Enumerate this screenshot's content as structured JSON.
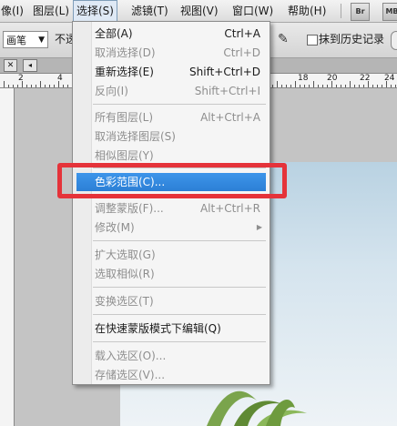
{
  "menubar": {
    "items": [
      "像(I)",
      "图层(L)",
      "选择(S)",
      "滤镜(T)",
      "视图(V)",
      "窗口(W)",
      "帮助(H)"
    ],
    "active_index": 2,
    "br_label": "Br",
    "mb_label": "MB"
  },
  "options": {
    "tool_value": "画笔",
    "opacity_label": "不透",
    "history_label": "抹到历史记录"
  },
  "ruler": {
    "numbers": [
      "2",
      "4",
      "18",
      "20",
      "22",
      "24",
      "2"
    ]
  },
  "select_menu": {
    "items": [
      {
        "label": "全部(A)",
        "shortcut": "Ctrl+A",
        "state": "enabled"
      },
      {
        "label": "取消选择(D)",
        "shortcut": "Ctrl+D",
        "state": "disabled"
      },
      {
        "label": "重新选择(E)",
        "shortcut": "Shift+Ctrl+D",
        "state": "enabled"
      },
      {
        "label": "反向(I)",
        "shortcut": "Shift+Ctrl+I",
        "state": "disabled"
      },
      {
        "label": "所有图层(L)",
        "shortcut": "Alt+Ctrl+A",
        "state": "disabled"
      },
      {
        "label": "取消选择图层(S)",
        "shortcut": "",
        "state": "disabled"
      },
      {
        "label": "相似图层(Y)",
        "shortcut": "",
        "state": "disabled"
      },
      {
        "label": "色彩范围(C)...",
        "shortcut": "",
        "state": "highlighted"
      },
      {
        "label": "调整蒙版(F)...",
        "shortcut": "Alt+Ctrl+R",
        "state": "disabled"
      },
      {
        "label": "修改(M)",
        "shortcut": "",
        "state": "disabled",
        "submenu": true
      },
      {
        "label": "扩大选取(G)",
        "shortcut": "",
        "state": "disabled"
      },
      {
        "label": "选取相似(R)",
        "shortcut": "",
        "state": "disabled"
      },
      {
        "label": "变换选区(T)",
        "shortcut": "",
        "state": "disabled"
      },
      {
        "label": "在快速蒙版模式下编辑(Q)",
        "shortcut": "",
        "state": "enabled"
      },
      {
        "label": "载入选区(O)...",
        "shortcut": "",
        "state": "disabled"
      },
      {
        "label": "存储选区(V)...",
        "shortcut": "",
        "state": "disabled"
      }
    ]
  },
  "colors": {
    "highlight": "#2c7fd6",
    "annotation": "#e5333a"
  }
}
